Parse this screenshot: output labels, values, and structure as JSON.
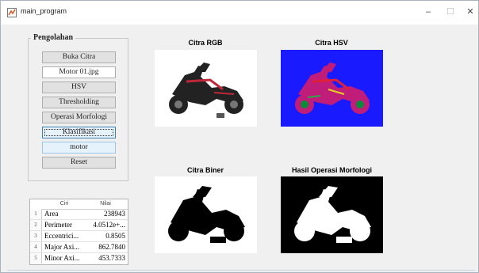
{
  "window": {
    "title": "main_program",
    "minimize": "–",
    "maximize": "☐",
    "close": "✕"
  },
  "panel": {
    "title": "Pengolahan",
    "buttons": [
      {
        "label": "Buka Citra"
      },
      {
        "label": "Motor 01.jpg"
      },
      {
        "label": "HSV"
      },
      {
        "label": "Thresholding"
      },
      {
        "label": "Operasi Morfologi"
      },
      {
        "label": "Klasifikasi"
      },
      {
        "label": "motor"
      },
      {
        "label": "Reset"
      }
    ]
  },
  "table": {
    "headers": [
      "Ciri",
      "Nilai"
    ],
    "rows": [
      {
        "num": "1",
        "name": "Area",
        "value": "238943"
      },
      {
        "num": "2",
        "name": "Perimeter",
        "value": "4.0512e+..."
      },
      {
        "num": "3",
        "name": "Eccentrici...",
        "value": "0.8505"
      },
      {
        "num": "4",
        "name": "Major Axi...",
        "value": "862.7840"
      },
      {
        "num": "5",
        "name": "Minor Axi...",
        "value": "453.7333"
      }
    ]
  },
  "images": {
    "rgb_title": "Citra RGB",
    "hsv_title": "Citra HSV",
    "biner_title": "Citra Biner",
    "morf_title": "Hasil Operasi Morfologi"
  },
  "colors": {
    "hsv_background": "#1a1aff",
    "window_background": "#f0f0f0"
  }
}
